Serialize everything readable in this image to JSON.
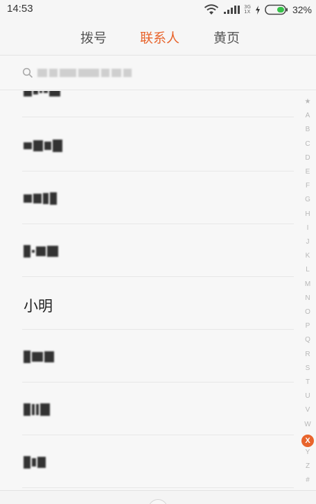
{
  "status_bar": {
    "time": "14:53",
    "network_top": "3G",
    "network_bottom": "1X",
    "battery": "32%",
    "icons": [
      "wifi-icon",
      "signal-icon",
      "charging-bolt-icon",
      "battery-icon"
    ]
  },
  "tabs": [
    {
      "label": "拨号",
      "active": false
    },
    {
      "label": "联系人",
      "active": true
    },
    {
      "label": "黄页",
      "active": false
    }
  ],
  "search": {
    "icon": "search-icon"
  },
  "contacts": [
    {
      "name": "小明"
    }
  ],
  "index_bar": {
    "letters": [
      "★",
      "A",
      "B",
      "C",
      "D",
      "E",
      "F",
      "G",
      "H",
      "I",
      "J",
      "K",
      "L",
      "M",
      "N",
      "O",
      "P",
      "Q",
      "R",
      "S",
      "T",
      "U",
      "V",
      "W",
      "X",
      "Y",
      "Z",
      "#"
    ],
    "active": "X"
  },
  "colors": {
    "accent": "#e8642c",
    "background": "#f7f7f7",
    "divider": "#e7e7e7"
  }
}
